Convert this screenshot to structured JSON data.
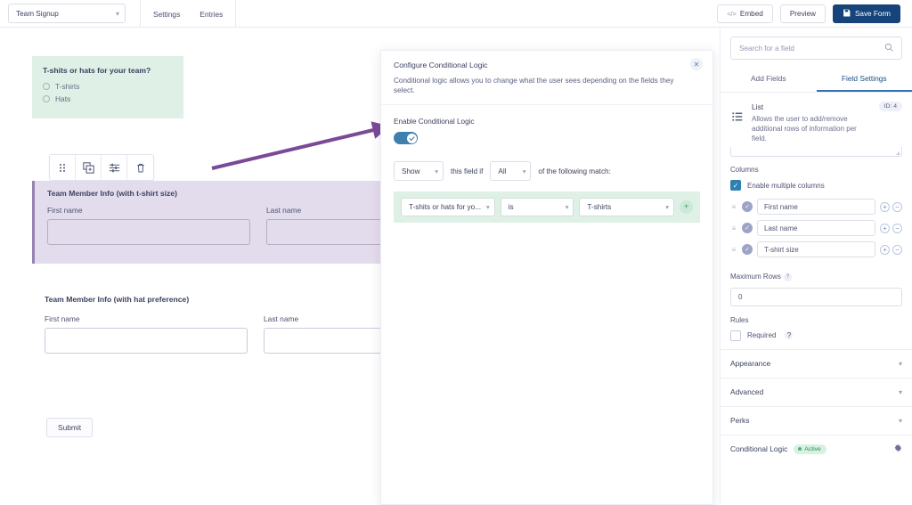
{
  "topbar": {
    "form_name": "Team Signup",
    "nav": [
      {
        "label": "Settings"
      },
      {
        "label": "Entries"
      }
    ],
    "embed_label": "Embed",
    "embed_icon": "code-icon",
    "preview_label": "Preview",
    "save_label": "Save Form",
    "save_icon": "save-disk-icon",
    "save_color": "#16447a"
  },
  "canvas": {
    "green_field": {
      "question": "T-shits or hats for your team?",
      "options": [
        "T-shirts",
        "Hats"
      ],
      "background": "#dff0e6"
    },
    "toolbar_icons": [
      "drag-handle-icon",
      "duplicate-icon",
      "settings-sliders-icon",
      "trash-icon"
    ],
    "selected_field": {
      "title": "Team Member Info (with t-shirt size)",
      "columns": [
        "First name",
        "Last name"
      ],
      "background": "#e3dcec",
      "accent": "#9683b0"
    },
    "second_field": {
      "title": "Team Member Info (with hat preference)",
      "columns": [
        "First name",
        "Last name"
      ]
    },
    "submit_label": "Submit",
    "arrow_color": "#7b4a96"
  },
  "modal": {
    "title": "Configure Conditional Logic",
    "description": "Conditional logic allows you to change what the user sees depending on the fields they select.",
    "close_icon": "close-icon",
    "enable_label": "Enable Conditional Logic",
    "toggle_on": true,
    "toggle_color": "#3f7fad",
    "action_value": "Show",
    "mid_text": "this field if",
    "match_value": "All",
    "trailing_text": "of the following match:",
    "rule": {
      "field_value": "T-shits or hats for yo...",
      "operator_value": "is",
      "compare_value": "T-shirts",
      "add_icon": "plus-icon",
      "strip_background": "#dff0e6"
    }
  },
  "sidebar": {
    "search_placeholder": "Search for a field",
    "search_icon": "search-icon",
    "tabs": [
      {
        "label": "Add Fields",
        "active": false
      },
      {
        "label": "Field Settings",
        "active": true
      }
    ],
    "field": {
      "icon": "list-icon",
      "name": "List",
      "description": "Allows the user to add/remove additional rows of information per field.",
      "id_badge": "ID: 4"
    },
    "columns": {
      "section_label": "Columns",
      "enable_label": "Enable multiple columns",
      "enabled": true,
      "items": [
        {
          "value": "First name"
        },
        {
          "value": "Last name"
        },
        {
          "value": "T-shirt size"
        }
      ],
      "add_icon": "plus-circle-icon",
      "remove_icon": "minus-circle-icon"
    },
    "maximum_rows": {
      "label": "Maximum Rows",
      "value": "0",
      "help_icon": "help-icon"
    },
    "rules": {
      "label": "Rules",
      "required_label": "Required",
      "required_checked": false,
      "help_icon": "help-icon"
    },
    "accordions": [
      {
        "label": "Appearance",
        "icon": "chevron-down-icon"
      },
      {
        "label": "Advanced",
        "icon": "chevron-down-icon"
      },
      {
        "label": "Perks",
        "icon": "chevron-down-icon"
      }
    ],
    "conditional_logic": {
      "label": "Conditional Logic",
      "badge": "Active",
      "badge_color": "#2f8a5b",
      "gear_icon": "gear-icon"
    }
  }
}
